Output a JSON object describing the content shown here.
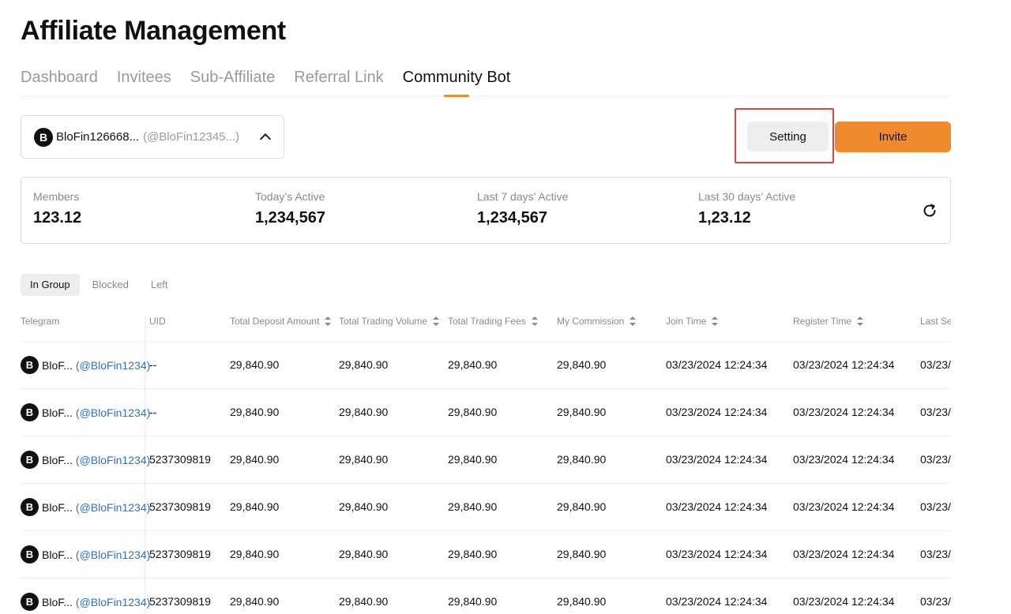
{
  "page": {
    "title": "Affiliate Management"
  },
  "tabs": [
    {
      "label": "Dashboard",
      "active": false
    },
    {
      "label": "Invitees",
      "active": false
    },
    {
      "label": "Sub-Affiliate",
      "active": false
    },
    {
      "label": "Referral Link",
      "active": false
    },
    {
      "label": "Community Bot",
      "active": true
    }
  ],
  "group_select": {
    "name": "BloFin126668...",
    "handle": "(@BloFin12345...)",
    "logo_letter": "B"
  },
  "actions": {
    "setting_label": "Setting",
    "invite_label": "Invite"
  },
  "stats": [
    {
      "label": "Members",
      "value": "123.12"
    },
    {
      "label": "Today’s Active",
      "value": "1,234,567"
    },
    {
      "label": "Last 7 days’ Active",
      "value": "1,234,567"
    },
    {
      "label": "Last 30 days’ Active",
      "value": "1,23.12"
    }
  ],
  "filters": [
    {
      "label": "In Group",
      "active": true
    },
    {
      "label": "Blocked",
      "active": false
    },
    {
      "label": "Left",
      "active": false
    }
  ],
  "table": {
    "columns": [
      {
        "label": "Telegram",
        "sortable": false
      },
      {
        "label": "UID",
        "sortable": false
      },
      {
        "label": "Total Deposit Amount",
        "sortable": true
      },
      {
        "label": "Total Trading Volume",
        "sortable": true
      },
      {
        "label": "Total Trading Fees",
        "sortable": true
      },
      {
        "label": "My Commission",
        "sortable": true
      },
      {
        "label": "Join Time",
        "sortable": true
      },
      {
        "label": "Register Time",
        "sortable": true
      },
      {
        "label": "Last Se",
        "sortable": false
      }
    ],
    "rows": [
      {
        "name": "BloF...",
        "handle": "(@BloFin1234)",
        "uid": "--",
        "deposit": "29,840.90",
        "volume": "29,840.90",
        "fees": "29,840.90",
        "commission": "29,840.90",
        "join": "03/23/2024 12:24:34",
        "register": "03/23/2024 12:24:34",
        "last": "03/23/"
      },
      {
        "name": "BloF...",
        "handle": "(@BloFin1234)",
        "uid": "--",
        "deposit": "29,840.90",
        "volume": "29,840.90",
        "fees": "29,840.90",
        "commission": "29,840.90",
        "join": "03/23/2024 12:24:34",
        "register": "03/23/2024 12:24:34",
        "last": "03/23/"
      },
      {
        "name": "BloF...",
        "handle": "(@BloFin1234)",
        "uid": "5237309819",
        "deposit": "29,840.90",
        "volume": "29,840.90",
        "fees": "29,840.90",
        "commission": "29,840.90",
        "join": "03/23/2024 12:24:34",
        "register": "03/23/2024 12:24:34",
        "last": "03/23/"
      },
      {
        "name": "BloF...",
        "handle": "(@BloFin1234)",
        "uid": "5237309819",
        "deposit": "29,840.90",
        "volume": "29,840.90",
        "fees": "29,840.90",
        "commission": "29,840.90",
        "join": "03/23/2024 12:24:34",
        "register": "03/23/2024 12:24:34",
        "last": "03/23/"
      },
      {
        "name": "BloF...",
        "handle": "(@BloFin1234)",
        "uid": "5237309819",
        "deposit": "29,840.90",
        "volume": "29,840.90",
        "fees": "29,840.90",
        "commission": "29,840.90",
        "join": "03/23/2024 12:24:34",
        "register": "03/23/2024 12:24:34",
        "last": "03/23/"
      },
      {
        "name": "BloF...",
        "handle": "(@BloFin1234)",
        "uid": "5237309819",
        "deposit": "29,840.90",
        "volume": "29,840.90",
        "fees": "29,840.90",
        "commission": "29,840.90",
        "join": "03/23/2024 12:24:34",
        "register": "03/23/2024 12:24:34",
        "last": "03/23/"
      }
    ]
  },
  "icons": {
    "dropdown": "chevron-up-icon",
    "refresh": "refresh-icon",
    "sort": "sort-icon",
    "logo": "blofin-logo-icon"
  },
  "colors": {
    "accent": "#f08a2e",
    "link": "#2d6fd6",
    "highlight": "#e0443a"
  }
}
